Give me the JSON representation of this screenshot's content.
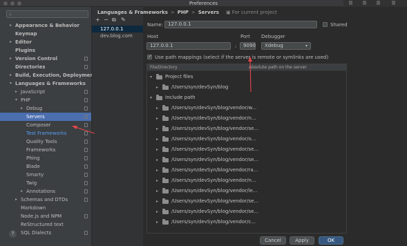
{
  "window": {
    "title": "Preferences"
  },
  "sidebar": {
    "search_placeholder": "",
    "items": [
      {
        "label": "Appearance & Behavior"
      },
      {
        "label": "Keymap"
      },
      {
        "label": "Editor"
      },
      {
        "label": "Plugins"
      },
      {
        "label": "Version Control"
      },
      {
        "label": "Directories"
      },
      {
        "label": "Build, Execution, Deployment"
      },
      {
        "label": "Languages & Frameworks"
      },
      {
        "label": "JavaScript"
      },
      {
        "label": "PHP"
      },
      {
        "label": "Debug"
      },
      {
        "label": "Servers"
      },
      {
        "label": "Composer"
      },
      {
        "label": "Test Frameworks"
      },
      {
        "label": "Quality Tools"
      },
      {
        "label": "Frameworks"
      },
      {
        "label": "Phing"
      },
      {
        "label": "Blade"
      },
      {
        "label": "Smarty"
      },
      {
        "label": "Twig"
      },
      {
        "label": "Annotations"
      },
      {
        "label": "Schemas and DTDs"
      },
      {
        "label": "Markdown"
      },
      {
        "label": "Node.js and NPM"
      },
      {
        "label": "ReStructured text"
      },
      {
        "label": "SQL Dialects"
      }
    ],
    "help": "?"
  },
  "server_list": {
    "toolbar": {
      "add": "+",
      "remove": "−",
      "copy": "⧉",
      "edit": "✎"
    },
    "items": [
      {
        "label": "127.0.0.1"
      },
      {
        "label": "dev.blog.com"
      }
    ]
  },
  "breadcrumb": {
    "parts": [
      "Languages & Frameworks",
      "PHP",
      "Servers"
    ],
    "separator": ">",
    "project_note": "For current project"
  },
  "form": {
    "name_label": "Name:",
    "name_value": "127.0.0.1",
    "shared_label": "Shared",
    "host_label": "Host",
    "host_value": "127.0.0.1",
    "colon": ":",
    "port_label": "Port",
    "port_value": "9090",
    "debugger_label": "Debugger",
    "debugger_value": "Xdebug",
    "path_mappings_label": "Use path mappings (select if the server is remote or symlinks are used)"
  },
  "mappings": {
    "col_file": "File/Directory",
    "col_absolute": "Absolute path on the server",
    "rows": [
      {
        "label": "Project files"
      },
      {
        "label": "/Users/syn/devSyn/blog"
      },
      {
        "label": "Include path"
      },
      {
        "label": "/Users/syn/devSyn/blog/vendor/w..."
      },
      {
        "label": "/Users/syn/devSyn/blog/vendor/n..."
      },
      {
        "label": "/Users/syn/devSyn/blog/vendor/se..."
      },
      {
        "label": "/Users/syn/devSyn/blog/vendor/o..."
      },
      {
        "label": "/Users/syn/devSyn/blog/vendor/se..."
      },
      {
        "label": "/Users/syn/devSyn/blog/vendor/se..."
      },
      {
        "label": "/Users/syn/devSyn/blog/vendor/ra..."
      },
      {
        "label": "/Users/syn/devSyn/blog/vendor/n..."
      },
      {
        "label": "/Users/syn/devSyn/blog/vendor/le..."
      },
      {
        "label": "/Users/syn/devSyn/blog/vendor/se..."
      },
      {
        "label": "/Users/syn/devSyn/blog/vendor/se..."
      },
      {
        "label": "/Users/syn/devSyn/blog/vendor/c..."
      }
    ]
  },
  "buttons": {
    "cancel": "Cancel",
    "apply": "Apply",
    "ok": "OK"
  },
  "colors": {
    "accent": "#4b6eaf",
    "annotation": "#e5474b",
    "primary_button": "#365880"
  }
}
